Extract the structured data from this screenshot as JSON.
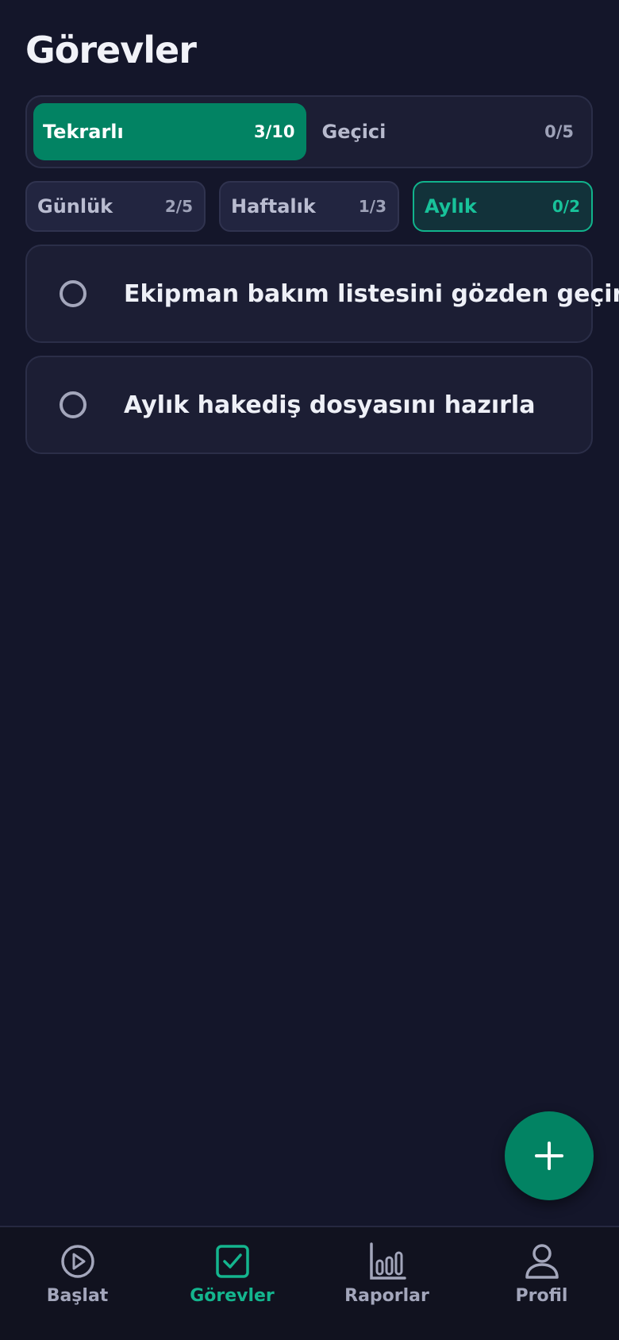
{
  "page": {
    "title": "Görevler"
  },
  "segments": [
    {
      "label": "Tekrarlı",
      "count": "3/10",
      "active": true
    },
    {
      "label": "Geçici",
      "count": "0/5",
      "active": false
    }
  ],
  "periods": [
    {
      "label": "Günlük",
      "count": "2/5",
      "active": false
    },
    {
      "label": "Haftalık",
      "count": "1/3",
      "active": false
    },
    {
      "label": "Aylık",
      "count": "0/2",
      "active": true
    }
  ],
  "tasks": [
    {
      "title": "Ekipman bakım listesini gözden geçir",
      "done": false
    },
    {
      "title": "Aylık hakediş dosyasını hazırla",
      "done": false
    }
  ],
  "fab": {
    "icon": "plus-icon"
  },
  "nav": {
    "items": [
      {
        "label": "Başlat",
        "icon": "play-icon",
        "active": false
      },
      {
        "label": "Görevler",
        "icon": "checkbox-icon",
        "active": true
      },
      {
        "label": "Raporlar",
        "icon": "bar-chart-icon",
        "active": false
      },
      {
        "label": "Profil",
        "icon": "user-icon",
        "active": false
      }
    ]
  },
  "colors": {
    "background": "#14162a",
    "accent": "#028363",
    "accent_text": "#14b58e",
    "card": "#1c1e34"
  }
}
